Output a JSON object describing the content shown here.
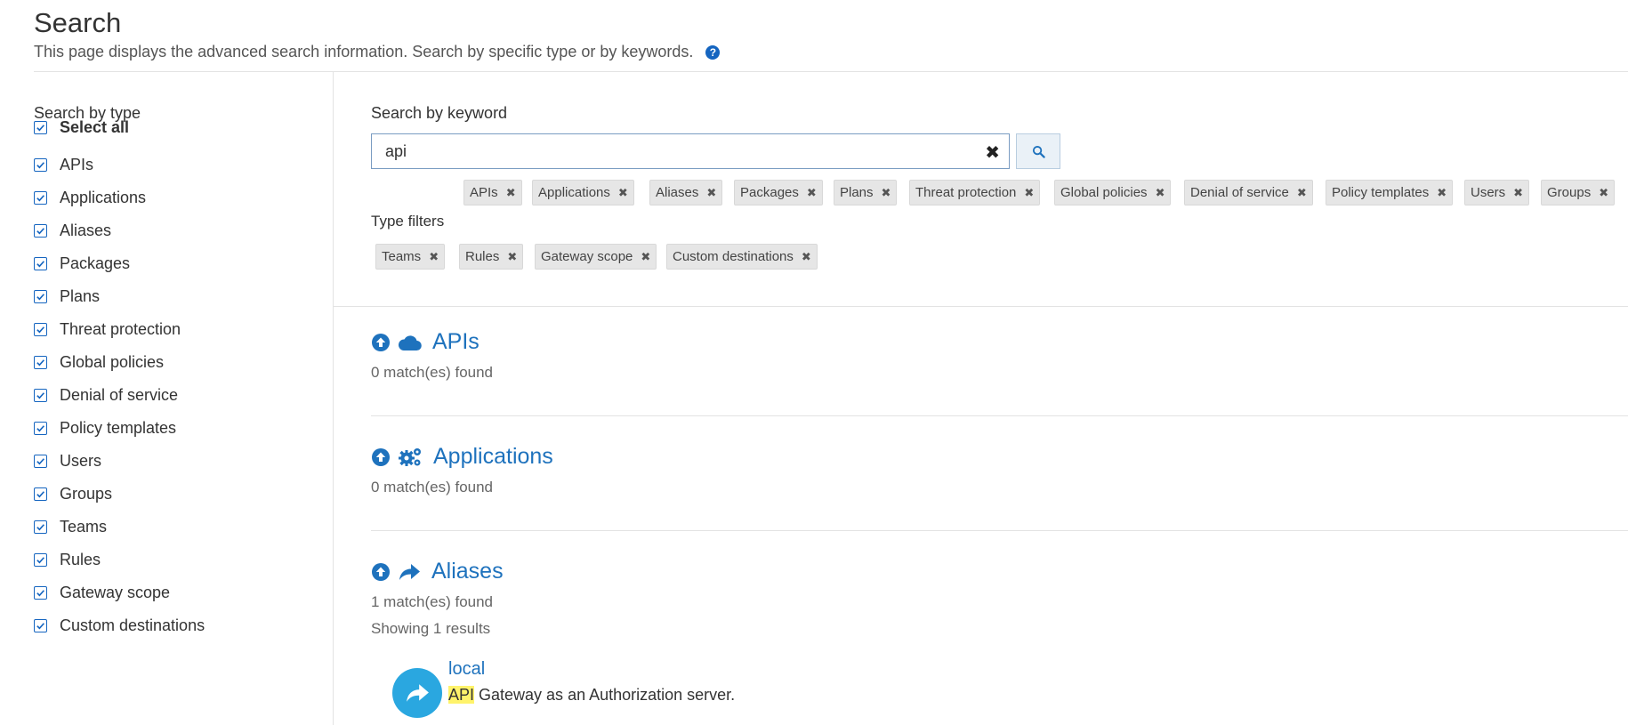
{
  "header": {
    "title": "Search",
    "description": "This page displays the advanced search information. Search by specific type or by keywords.",
    "help_icon": "?"
  },
  "sidebar": {
    "title": "Search by type",
    "select_all": "Select all",
    "items": [
      "APIs",
      "Applications",
      "Aliases",
      "Packages",
      "Plans",
      "Threat protection",
      "Global policies",
      "Denial of service",
      "Policy templates",
      "Users",
      "Groups",
      "Teams",
      "Rules",
      "Gateway scope",
      "Custom destinations"
    ]
  },
  "keyword": {
    "label": "Search by keyword",
    "value": "api",
    "clear_icon": "✖",
    "search_icon": "search-icon"
  },
  "filters": {
    "label": "Type filters",
    "chips": [
      "APIs",
      "Applications",
      "Aliases",
      "Packages",
      "Plans",
      "Threat protection",
      "Global policies",
      "Denial of service",
      "Policy templates",
      "Users",
      "Groups",
      "Teams",
      "Rules",
      "Gateway scope",
      "Custom destinations"
    ],
    "chip_remove_icon": "✖"
  },
  "sections": [
    {
      "title": "APIs",
      "icon": "cloud-icon",
      "count": "0 match(es) found"
    },
    {
      "title": "Applications",
      "icon": "gears-icon",
      "count": "0 match(es) found"
    },
    {
      "title": "Aliases",
      "icon": "share-arrow-icon",
      "count": "1 match(es) found",
      "showing": "Showing 1 results"
    }
  ],
  "result": {
    "title": "local",
    "highlight": "API",
    "desc_rest": " Gateway as an Authorization server."
  },
  "colors": {
    "accent": "#1e72bd",
    "checkbox": "#1565c0",
    "avatar": "#2aa7e0",
    "highlight": "#fff36b"
  }
}
